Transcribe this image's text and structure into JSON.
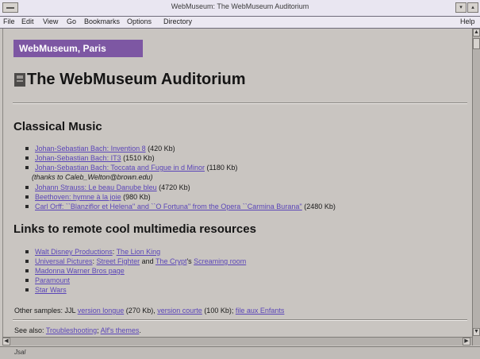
{
  "window": {
    "title": "WebMuseum: The WebMuseum Auditorium"
  },
  "menu": [
    "File",
    "Edit",
    "View",
    "Go",
    "Bookmarks",
    "Options",
    "Directory"
  ],
  "menu_help": "Help",
  "page": {
    "badge": "WebMuseum, Paris",
    "title": "The WebMuseum Auditorium",
    "classical_heading": "Classical Music",
    "classical": [
      {
        "link": "Johan-Sebastian Bach: Invention 8",
        "size": "(420 Kb)"
      },
      {
        "link": "Johan-Sebastian Bach: IT3",
        "size": "(1510 Kb)"
      },
      {
        "link": "Johan-Sebastian Bach: Toccata and Fugue in d Minor",
        "size": "(1180 Kb)",
        "note": "(thanks to Caleb_Welton@brown.edu)"
      },
      {
        "link": "Johann Strauss: Le beau Danube bleu",
        "size": "(4720 Kb)"
      },
      {
        "link": "Beethoven: hymne à la joie",
        "size": "(980 Kb)"
      },
      {
        "link": "Carl Orff: ``Blanziflor et Helena'' and ``O Fortuna'' from the Opera ``Carmina Burana''",
        "size": "(2480 Kb)"
      }
    ],
    "links_heading": "Links to remote cool multimedia resources",
    "links": {
      "disney_prefix": "Walt Disney Productions",
      "disney_sep": ": ",
      "disney_link": "The Lion King",
      "universal_prefix": "Universal Pictures",
      "universal_sep": ": ",
      "universal_link1": "Street Fighter",
      "universal_and": " and ",
      "universal_link2": "The Crypt",
      "universal_poss": "'s ",
      "universal_link3": "Screaming room",
      "madonna": "Madonna Warner Bros page",
      "paramount": "Paramount",
      "starwars": "Star Wars"
    },
    "other": {
      "prefix": "Other samples: JJL ",
      "link1": "version longue",
      "size1": " (270 Kb), ",
      "link2": "version courte",
      "size2": " (100 Kb); ",
      "link3": "file aux Enfants"
    },
    "see_also": {
      "prefix": "See also: ",
      "link1": "Troubleshooting",
      "sep": "; ",
      "link2": "Alf's themes",
      "end": "."
    }
  },
  "status": {
    "text": "Jsal"
  },
  "icons": [
    "system-menu-icon",
    "minimize-icon",
    "maximize-icon",
    "page-icon",
    "scroll-up-icon",
    "scroll-down-icon",
    "scroll-left-icon",
    "scroll-right-icon"
  ],
  "colors": {
    "link": "#5a45b8",
    "badge": "#7d57a3",
    "background": "#c9c5c1"
  }
}
